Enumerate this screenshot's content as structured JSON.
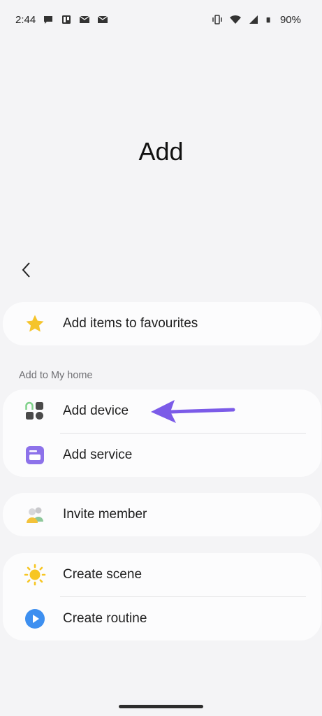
{
  "status_bar": {
    "time": "2:44",
    "battery": "90%"
  },
  "page": {
    "title": "Add"
  },
  "favourites": {
    "label": "Add items to favourites"
  },
  "my_home": {
    "section_label": "Add to My home",
    "items": [
      {
        "label": "Add device",
        "icon": "device-grid-icon"
      },
      {
        "label": "Add service",
        "icon": "service-icon"
      }
    ]
  },
  "members": {
    "label": "Invite member",
    "icon": "people-icon"
  },
  "automation": {
    "items": [
      {
        "label": "Create scene",
        "icon": "sun-icon"
      },
      {
        "label": "Create routine",
        "icon": "play-icon"
      }
    ]
  },
  "colors": {
    "accent_arrow": "#7b5be8",
    "star": "#f5c42b",
    "routine": "#3d8ff0"
  }
}
